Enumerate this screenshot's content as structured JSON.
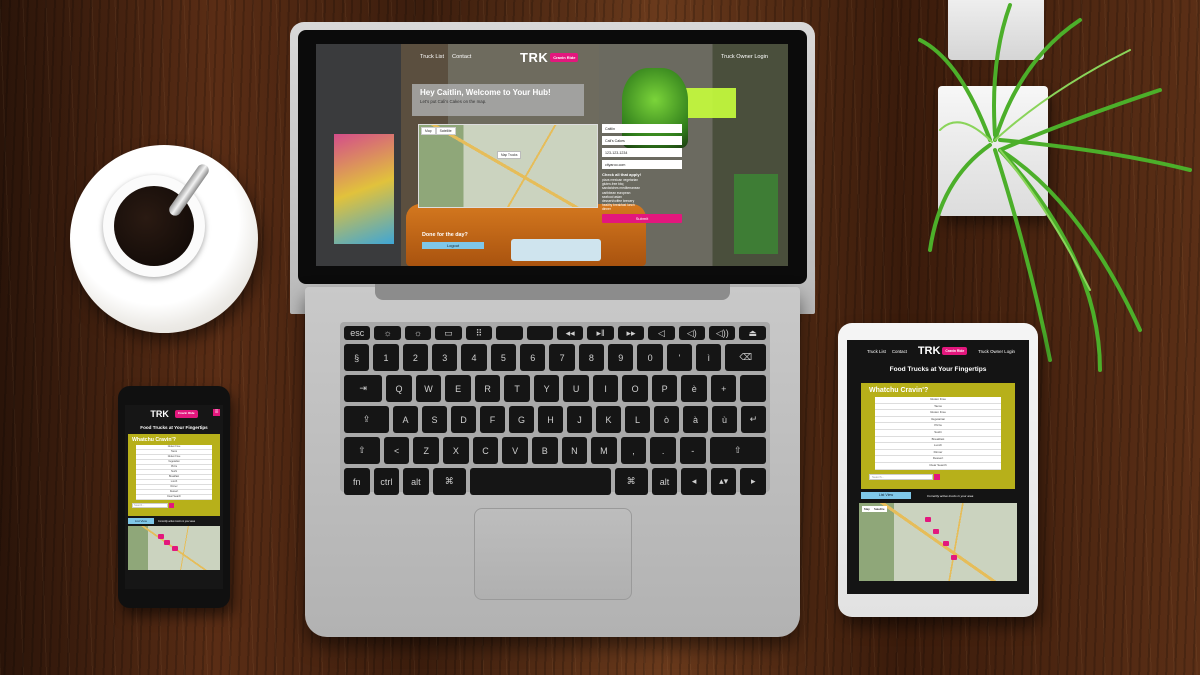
{
  "laptop": {
    "nav": {
      "truck_list": "Truck List",
      "contact": "Contact",
      "owner_login": "Truck Owner Login"
    },
    "logo": {
      "text": "TRK",
      "badge": "Cravin Ride"
    },
    "hero": {
      "title": "Hey Caitlin, Welcome to Your Hub!",
      "subtitle": "Let's put Cali's Cakes on the map."
    },
    "map": {
      "tab_map": "Map",
      "tab_satellite": "Satellite",
      "dropdown": "Map Trucks"
    },
    "form": {
      "fields": [
        "Caitlin",
        "Cali's Cakes",
        "123-123-1234",
        "cityaroo.com"
      ],
      "check_title": "Check all that apply!",
      "checks": [
        "pizza  mexican  vegetarian",
        "gluten-free  bbq",
        "sandwiches  mediterranean",
        "caribbean  european",
        "seafood  asian",
        "dessert/coffee  brewery",
        "healthy  breakfast  lunch",
        "dinner"
      ],
      "submit": "Submit"
    },
    "done": {
      "title": "Done for the day?",
      "logout": "Logout"
    }
  },
  "tablet": {
    "nav": {
      "truck_list": "Truck List",
      "contact": "Contact",
      "owner_login": "Truck Owner Login"
    },
    "logo": {
      "text": "TRK",
      "badge": "Cravin Ride"
    },
    "tagline": "Food Trucks at Your Fingertips",
    "panel_title": "Whatchu Cravin'?",
    "list": [
      "Gluten Free",
      "Tacos",
      "Gluten Free",
      "Vegetarian",
      "Pizza",
      "Sushi",
      "Breakfast",
      "Lunch",
      "Dinner",
      "Dessert",
      "Clear Search"
    ],
    "search_placeholder": "Search...",
    "list_view": "List View",
    "note": "Currently active trucks in your area",
    "map_tab_map": "Map",
    "map_tab_sat": "Satellite"
  },
  "phone": {
    "logo": {
      "text": "TRK",
      "badge": "Cravin Ride"
    },
    "tagline": "Food Trucks at Your Fingertips",
    "panel_title": "Whatchu Cravin'?",
    "list": [
      "Gluten Free",
      "Tacos",
      "Gluten Free",
      "Vegetarian",
      "Pizza",
      "Sushi",
      "Breakfast",
      "Lunch",
      "Dinner",
      "Dessert",
      "Clear Search"
    ],
    "search_placeholder": "Search...",
    "list_view": "List View",
    "note": "Currently active trucks in your area"
  },
  "keyboard": {
    "row1": [
      "esc",
      "☼",
      "☼",
      "▭",
      "⠿",
      "",
      "",
      "◂◂",
      "▸‖",
      "▸▸",
      "◁",
      "◁)",
      "◁))",
      "⏏"
    ],
    "row2": [
      "§",
      "1",
      "2",
      "3",
      "4",
      "5",
      "6",
      "7",
      "8",
      "9",
      "0",
      "'",
      "ì",
      "⌫"
    ],
    "row3": [
      "⇥",
      "Q",
      "W",
      "E",
      "R",
      "T",
      "Y",
      "U",
      "I",
      "O",
      "P",
      "è",
      "+",
      ""
    ],
    "row4": [
      "⇪",
      "A",
      "S",
      "D",
      "F",
      "G",
      "H",
      "J",
      "K",
      "L",
      "ò",
      "à",
      "ù",
      "↵"
    ],
    "row5": [
      "⇧",
      "<",
      "Z",
      "X",
      "C",
      "V",
      "B",
      "N",
      "M",
      ",",
      ".",
      "-",
      "⇧"
    ],
    "row6": [
      "fn",
      "ctrl",
      "alt",
      "⌘",
      "",
      "⌘",
      "alt",
      "◂",
      "▴▾",
      "▸"
    ]
  }
}
